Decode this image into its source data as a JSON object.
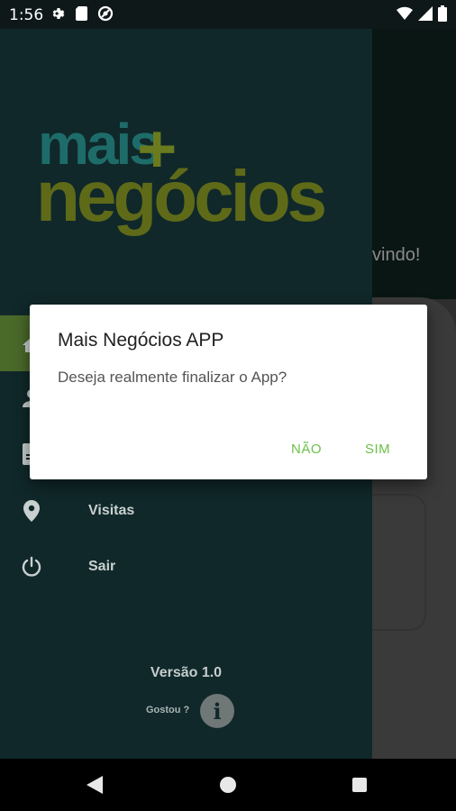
{
  "status_bar": {
    "time": "1:56",
    "left_icons": [
      "settings-icon",
      "sim-card-icon",
      "data-saver-icon"
    ],
    "right_icons": [
      "wifi-icon",
      "cell-signal-icon",
      "battery-icon"
    ]
  },
  "background": {
    "welcome_text": "vindo!"
  },
  "drawer": {
    "logo": {
      "line1": "mais",
      "plus": "+",
      "line2": "negócios"
    },
    "items": [
      {
        "label": "",
        "icon": "home-icon",
        "active": true
      },
      {
        "label": "",
        "icon": "person-icon"
      },
      {
        "label": "",
        "icon": "document-icon"
      },
      {
        "label": "Visitas",
        "icon": "location-pin-icon"
      },
      {
        "label": "Sair",
        "icon": "power-icon"
      }
    ],
    "version": "Versão 1.0",
    "feedback_label": "Gostou ?",
    "info_glyph": "i"
  },
  "dialog": {
    "title": "Mais Negócios APP",
    "message": "Deseja realmente finalizar o App?",
    "negative_button": "NÃO",
    "positive_button": "SIM"
  },
  "colors": {
    "accent": "#6cc04a",
    "drawer_bg": "#10282a",
    "active_item": "#4a6a2a"
  },
  "nav_bar": {
    "icons": [
      "back-icon",
      "home-icon",
      "recents-icon"
    ]
  }
}
